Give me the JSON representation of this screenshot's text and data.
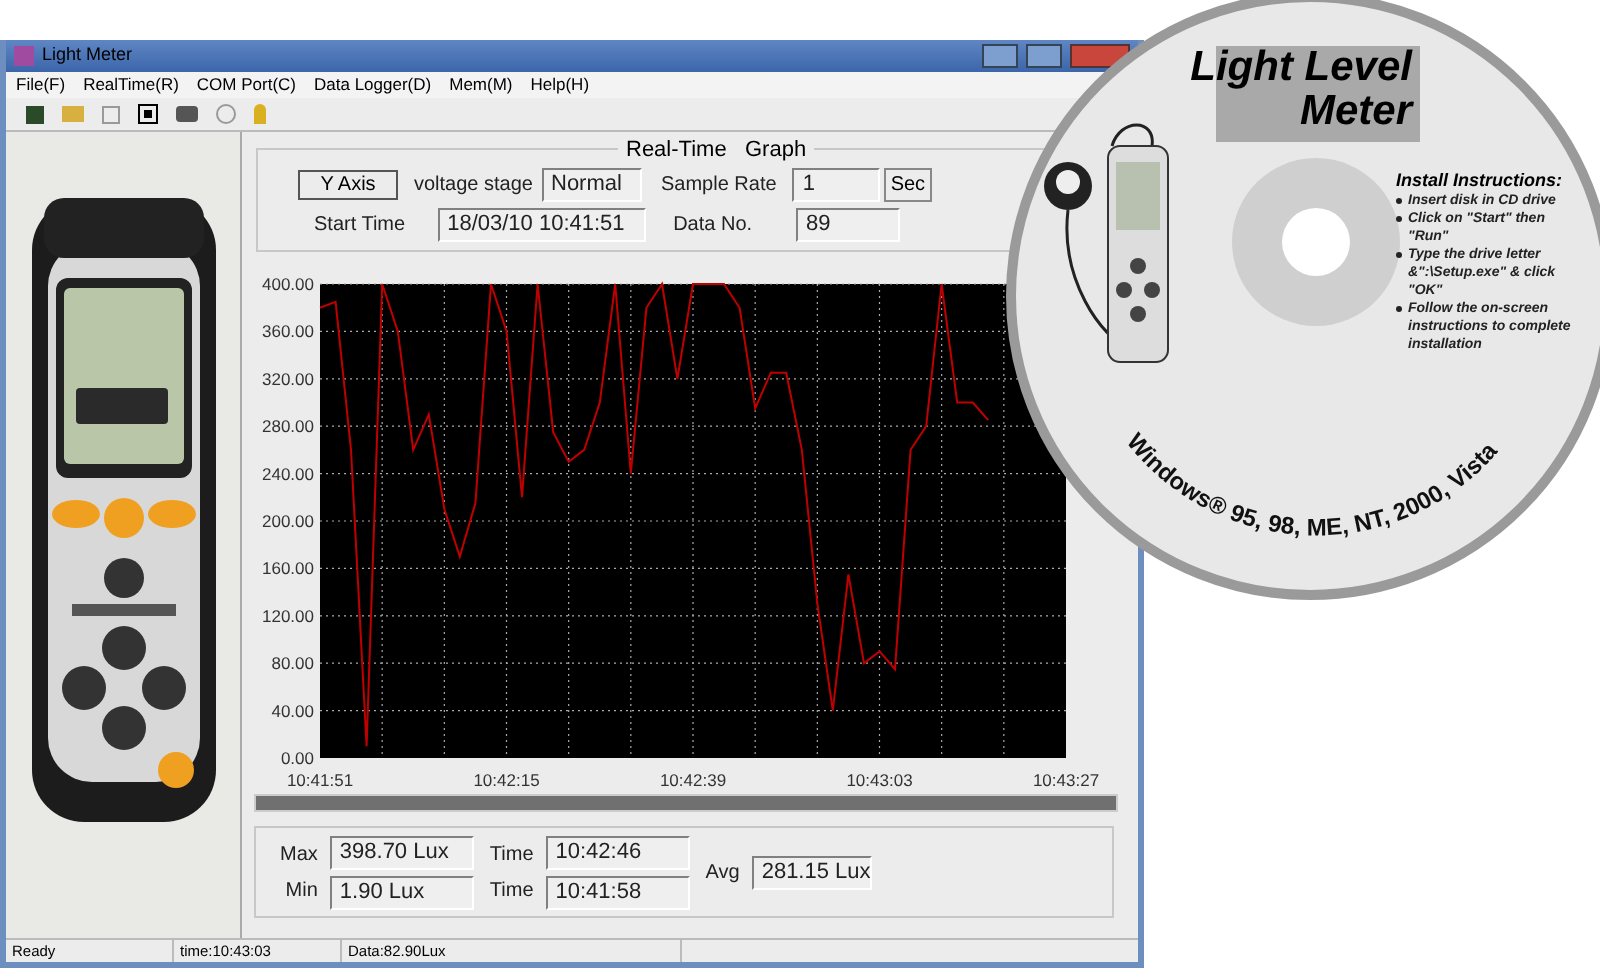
{
  "window": {
    "title": "Light Meter"
  },
  "menu": [
    "File(F)",
    "RealTime(R)",
    "COM Port(C)",
    "Data Logger(D)",
    "Mem(M)",
    "Help(H)"
  ],
  "graph_panel": {
    "title": "Real-Time   Graph",
    "y_axis_button": "Y Axis",
    "voltage_label": "voltage stage",
    "voltage_value": "Normal",
    "rate_label": "Sample Rate",
    "rate_value": "1",
    "rate_unit_button": "Sec",
    "start_label": "Start Time",
    "start_value": "18/03/10 10:41:51",
    "count_label": "Data No.",
    "count_value": "89"
  },
  "chart_data": {
    "type": "line",
    "categories": [
      "10:41:51",
      null,
      null,
      null,
      null,
      null,
      null,
      null,
      null,
      null,
      null,
      null,
      "10:42:15",
      null,
      null,
      null,
      null,
      null,
      null,
      null,
      null,
      null,
      null,
      null,
      "10:42:39",
      null,
      null,
      null,
      null,
      null,
      null,
      null,
      null,
      null,
      null,
      null,
      "10:43:03",
      null,
      null,
      null,
      null,
      null,
      null,
      null,
      null,
      null,
      null,
      null,
      "10:43:27"
    ],
    "series": [
      {
        "color": "#c00000",
        "values": [
          380,
          385,
          260,
          10,
          400,
          360,
          260,
          290,
          210,
          170,
          215,
          400,
          360,
          220,
          400,
          275,
          250,
          260,
          300,
          400,
          240,
          380,
          400,
          320,
          400,
          400,
          400,
          380,
          295,
          325,
          325,
          260,
          130,
          40,
          155,
          80,
          90,
          75,
          260,
          280,
          400,
          300,
          300,
          285,
          null,
          null,
          null,
          null,
          null
        ]
      }
    ],
    "ylim": [
      0,
      400
    ],
    "grid": true,
    "yticks": [
      {
        "value": 0,
        "label": "0.00"
      },
      {
        "value": 40,
        "label": "40.00"
      },
      {
        "value": 80,
        "label": "80.00"
      },
      {
        "value": 120,
        "label": "120.00"
      },
      {
        "value": 160,
        "label": "160.00"
      },
      {
        "value": 200,
        "label": "200.00"
      },
      {
        "value": 240,
        "label": "240.00"
      },
      {
        "value": 280,
        "label": "280.00"
      },
      {
        "value": 320,
        "label": "320.00"
      },
      {
        "value": 360,
        "label": "360.00"
      },
      {
        "value": 400,
        "label": "400.00"
      }
    ]
  },
  "stats": {
    "max_label": "Max",
    "max_value": "398.70  Lux",
    "max_time_label": "Time",
    "max_time": "10:42:46",
    "min_label": "Min",
    "min_value": "1.90  Lux",
    "min_time_label": "Time",
    "min_time": "10:41:58",
    "avg_label": "Avg",
    "avg_value": "281.15  Lux"
  },
  "status_bar": [
    "Ready",
    "time:10:43:03",
    "Data:82.90Lux"
  ],
  "cd": {
    "title_lines": [
      "Light Level",
      "Meter"
    ],
    "install_heading": "Install Instructions:",
    "steps": [
      "Insert disk in CD drive",
      "Click on \"Start\" then \"Run\"",
      "Type the drive letter &\":\\Setup.exe\" & click \"OK\"",
      "Follow the on-screen instructions to complete installation"
    ],
    "os_text": "Windows® 95, 98, ME, NT, 2000, Vista"
  }
}
